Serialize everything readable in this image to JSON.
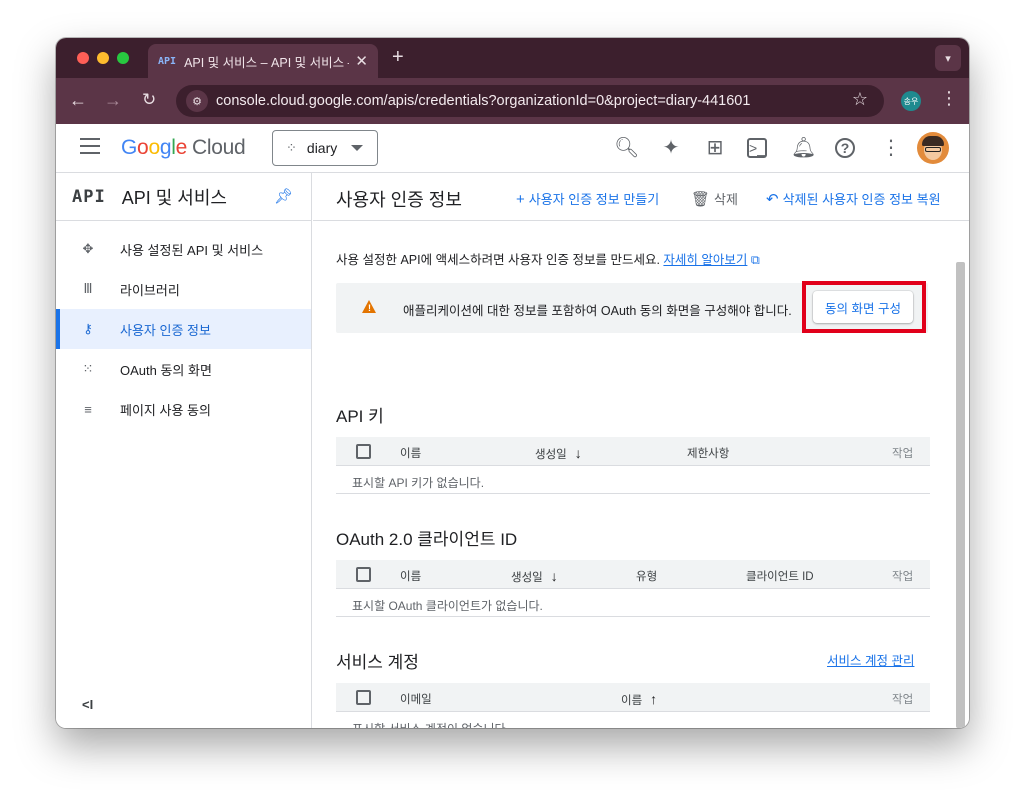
{
  "browser": {
    "tab_favicon": "API",
    "tab_title": "API 및 서비스 – API 및 서비스 – ",
    "tab_close": "✕",
    "new_tab": "+",
    "tab_menu": "▾",
    "url": "console.cloud.google.com/apis/credentials?organizationId=0&project=diary-441601",
    "profile_label": "송우"
  },
  "gcp_header": {
    "logo_parts": [
      "G",
      "o",
      "o",
      "g",
      "l",
      "e"
    ],
    "logo_cloud": "Cloud",
    "project_name": "diary"
  },
  "sidebar": {
    "mark": "API",
    "title": "API 및 서비스",
    "items": [
      {
        "label": "사용 설정된 API 및 서비스",
        "icon": "diamond-icon"
      },
      {
        "label": "라이브러리",
        "icon": "library-icon"
      },
      {
        "label": "사용자 인증 정보",
        "icon": "key-icon"
      },
      {
        "label": "OAuth 동의 화면",
        "icon": "oauth-icon"
      },
      {
        "label": "페이지 사용 동의",
        "icon": "settings-list-icon"
      }
    ],
    "collapse_label": "<I"
  },
  "main": {
    "title": "사용자 인증 정보",
    "actions": {
      "create": "사용자 인증 정보 만들기",
      "delete": "삭제",
      "restore": "삭제된 사용자 인증 정보 복원"
    },
    "intro_text": "사용 설정한 API에 액세스하려면 사용자 인증 정보를 만드세요.",
    "intro_link": "자세히 알아보기",
    "banner_text": "애플리케이션에 대한 정보를 포함하여 OAuth 동의 화면을 구성해야 합니다.",
    "banner_button": "동의 화면 구성",
    "api_keys": {
      "title": "API 키",
      "columns": [
        "이름",
        "생성일",
        "제한사항",
        "작업"
      ],
      "sort_arrow": "↓",
      "empty": "표시할 API 키가 없습니다."
    },
    "oauth_clients": {
      "title": "OAuth 2.0 클라이언트 ID",
      "columns": [
        "이름",
        "생성일",
        "유형",
        "클라이언트 ID",
        "작업"
      ],
      "sort_arrow": "↓",
      "empty": "표시할 OAuth 클라이언트가 없습니다."
    },
    "service_accounts": {
      "title": "서비스 계정",
      "manage_link": "서비스 계정 관리",
      "columns": [
        "이메일",
        "이름",
        "작업"
      ],
      "sort_arrow": "↑",
      "empty": "표시할 서비스 계정이 없습니다."
    }
  },
  "colors": {
    "accent": "#1a73e8",
    "warning": "#e37400",
    "highlight_box": "#e1001a",
    "browser_frame": "#5b3547"
  }
}
